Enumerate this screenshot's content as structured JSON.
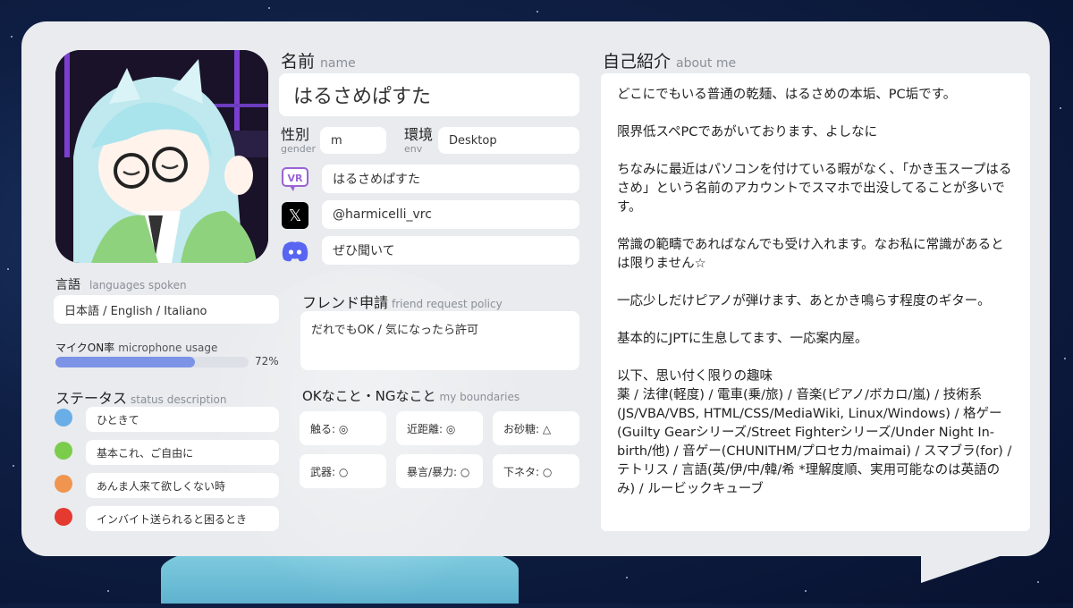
{
  "colors": {
    "card": "#e9ebee",
    "accent_bar": "#7c93e6",
    "status_blue": "#6aaee8",
    "status_green": "#7ccc4b",
    "status_orange": "#f0954f",
    "status_red": "#e43a2f",
    "discord": "#5865f2"
  },
  "name": {
    "label_jp": "名前",
    "label_en": "name",
    "value": "はるさめぱすた"
  },
  "gender": {
    "label_jp": "性別",
    "label_en": "gender",
    "value": "m"
  },
  "env": {
    "label_jp": "環境",
    "label_en": "env",
    "value": "Desktop"
  },
  "accounts": [
    {
      "icon": "vrchat-icon",
      "icon_text": "VR",
      "value": "はるさめぱすた"
    },
    {
      "icon": "x-icon",
      "icon_text": "𝕏",
      "value": "@harmicelli_vrc"
    },
    {
      "icon": "discord-icon",
      "value": "ぜひ聞いて"
    }
  ],
  "languages": {
    "label_jp": "言語",
    "label_en": "languages spoken",
    "value": "日本語 / English / Italiano"
  },
  "microphone": {
    "label_jp": "マイクON率",
    "label_en": "microphone usage",
    "value": "72%",
    "fraction": 0.72
  },
  "status": {
    "label_jp": "ステータス",
    "label_en": "status description",
    "items": [
      {
        "color": "#6aaee8",
        "text": "ひときて"
      },
      {
        "color": "#7ccc4b",
        "text": "基本これ、ご自由に"
      },
      {
        "color": "#f0954f",
        "text": "あんま人来て欲しくない時"
      },
      {
        "color": "#e43a2f",
        "text": "インバイト送られると困るとき"
      }
    ]
  },
  "friend_request": {
    "label_jp": "フレンド申請",
    "label_en": "friend request policy",
    "value": "だれでもOK / 気になったら許可"
  },
  "boundaries": {
    "label_jp": "OKなこと・NGなこと",
    "label_en": "my boundaries",
    "items": [
      "触る: ◎",
      "近距離: ◎",
      "お砂糖: △",
      "武器: ○",
      "暴言/暴力: ○",
      "下ネタ: ○"
    ]
  },
  "about": {
    "label_jp": "自己紹介",
    "label_en": "about me",
    "text": "どこにでもいる普通の乾麺、はるさめの本垢、PC垢です。\n\n限界低スペPCであがいております、よしなに\n\nちなみに最近はパソコンを付けている暇がなく、「かき玉スープはるさめ」という名前のアカウントでスマホで出没してることが多いです。\n\n常識の範疇であればなんでも受け入れます。なお私に常識があるとは限りません☆\n\n一応少しだけピアノが弾けます、あとかき鳴らす程度のギター。\n\n基本的にJPTに生息してます、一応案内屋。\n\n以下、思い付く限りの趣味\n薬 / 法律(軽度) / 電車(乗/旅) / 音楽(ピアノ/ボカロ/嵐) / 技術系(JS/VBA/VBS, HTML/CSS/MediaWiki, Linux/Windows) / 格ゲー(Guilty Gearシリーズ/Street Fighterシリーズ/Under Night In-birth/他) / 音ゲー(CHUNITHM/プロセカ/maimai) / スマブラ(for) / テトリス / 言語(英/伊/中/韓/希 *理解度順、実用可能なのは英語のみ) / ルービックキューブ"
  }
}
